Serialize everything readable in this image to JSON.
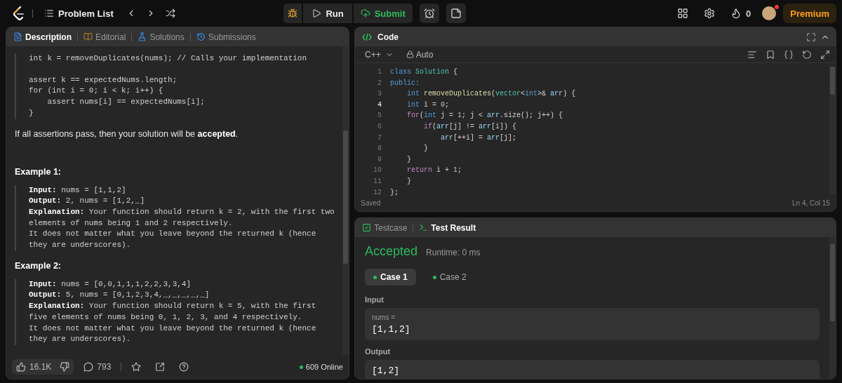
{
  "nav": {
    "problem_list": "Problem List",
    "run": "Run",
    "submit": "Submit",
    "streak": "0",
    "premium": "Premium",
    "notification": true
  },
  "description": {
    "tabs": [
      {
        "label": "Description",
        "selected": true
      },
      {
        "label": "Editorial",
        "selected": false
      },
      {
        "label": "Solutions",
        "selected": false
      },
      {
        "label": "Submissions",
        "selected": false
      }
    ],
    "code_top": [
      [
        "int k = removeDuplicates(nums); // Calls your implementation"
      ],
      [
        "assert k == expectedNums.length;",
        "for (int i = 0; i < k; i++) {",
        "    assert nums[i] == expectedNums[i];",
        "}"
      ]
    ],
    "note": "If all assertions pass, then your solution will be **accepted**.",
    "examples": [
      {
        "title": "Example 1:",
        "lines": [
          "**Input:** nums = [1,1,2]",
          "**Output:** 2, nums = [1,2,_]",
          "**Explanation:** Your function should return k = 2, with the first two elements of nums being 1 and 2 respectively.",
          "It does not matter what you leave beyond the returned k (hence they are underscores)."
        ]
      },
      {
        "title": "Example 2:",
        "lines": [
          "**Input:** nums = [0,0,1,1,1,2,2,3,3,4]",
          "**Output:** 5, nums = [0,1,2,3,4,_,_,_,_,_]",
          "**Explanation:** Your function should return k = 5, with the first five elements of nums being 0, 1, 2, 3, and 4 respectively.",
          "It does not matter what you leave beyond the returned k (hence they are underscores)."
        ]
      }
    ],
    "likes": "16.1K",
    "comments": "793",
    "online": "609 Online"
  },
  "code": {
    "title": "Code",
    "language": "C++",
    "mode": "Auto",
    "status": "Saved",
    "cursor": "Ln 4, Col 15",
    "lines": [
      {
        "n": "1",
        "current": false,
        "tokens": [
          {
            "t": "class ",
            "kind": "keyword"
          },
          {
            "t": "Solution",
            "kind": "type"
          },
          {
            "t": " {",
            "kind": "plain"
          }
        ]
      },
      {
        "n": "2",
        "current": false,
        "tokens": [
          {
            "t": "public:",
            "kind": "keyword"
          }
        ]
      },
      {
        "n": "3",
        "current": false,
        "tokens": [
          {
            "t": "    int ",
            "kind": "keyword"
          },
          {
            "t": "removeDuplicates",
            "kind": "function"
          },
          {
            "t": "(",
            "kind": "plain"
          },
          {
            "t": "vector",
            "kind": "type"
          },
          {
            "t": "<",
            "kind": "plain"
          },
          {
            "t": "int",
            "kind": "keyword"
          },
          {
            "t": ">& ",
            "kind": "plain"
          },
          {
            "t": "arr",
            "kind": "variable"
          },
          {
            "t": ") {",
            "kind": "plain"
          }
        ]
      },
      {
        "n": "4",
        "current": true,
        "tokens": [
          {
            "t": "    int ",
            "kind": "keyword"
          },
          {
            "t": "i = ",
            "kind": "plain"
          },
          {
            "t": "0",
            "kind": "number"
          },
          {
            "t": ";",
            "kind": "plain"
          }
        ]
      },
      {
        "n": "5",
        "current": false,
        "tokens": [
          {
            "t": "    for",
            "kind": "control"
          },
          {
            "t": "(",
            "kind": "plain"
          },
          {
            "t": "int ",
            "kind": "keyword"
          },
          {
            "t": "j = ",
            "kind": "plain"
          },
          {
            "t": "1",
            "kind": "number"
          },
          {
            "t": "; j < ",
            "kind": "plain"
          },
          {
            "t": "arr",
            "kind": "variable"
          },
          {
            "t": ".size(); j++) {",
            "kind": "plain"
          }
        ]
      },
      {
        "n": "6",
        "current": false,
        "tokens": [
          {
            "t": "        if",
            "kind": "control"
          },
          {
            "t": "(",
            "kind": "plain"
          },
          {
            "t": "arr",
            "kind": "variable"
          },
          {
            "t": "[j] != ",
            "kind": "plain"
          },
          {
            "t": "arr",
            "kind": "variable"
          },
          {
            "t": "[i]) {",
            "kind": "plain"
          }
        ]
      },
      {
        "n": "7",
        "current": false,
        "tokens": [
          {
            "t": "            arr",
            "kind": "variable"
          },
          {
            "t": "[++i] = ",
            "kind": "plain"
          },
          {
            "t": "arr",
            "kind": "variable"
          },
          {
            "t": "[j];",
            "kind": "plain"
          }
        ]
      },
      {
        "n": "8",
        "current": false,
        "tokens": [
          {
            "t": "        }",
            "kind": "plain"
          }
        ]
      },
      {
        "n": "9",
        "current": false,
        "tokens": [
          {
            "t": "    }",
            "kind": "plain"
          }
        ]
      },
      {
        "n": "10",
        "current": false,
        "tokens": [
          {
            "t": "    return ",
            "kind": "control"
          },
          {
            "t": "i + ",
            "kind": "plain"
          },
          {
            "t": "1",
            "kind": "number"
          },
          {
            "t": ";",
            "kind": "plain"
          }
        ]
      },
      {
        "n": "11",
        "current": false,
        "tokens": [
          {
            "t": "    }",
            "kind": "plain"
          }
        ]
      },
      {
        "n": "12",
        "current": false,
        "tokens": [
          {
            "t": "};",
            "kind": "plain"
          }
        ]
      }
    ]
  },
  "result": {
    "tabs": [
      {
        "label": "Testcase",
        "selected": false
      },
      {
        "label": "Test Result",
        "selected": true
      }
    ],
    "verdict": "Accepted",
    "runtime": "Runtime: 0 ms",
    "cases": [
      {
        "label": "Case 1",
        "selected": true
      },
      {
        "label": "Case 2",
        "selected": false
      }
    ],
    "input_label": "Input",
    "input_var": "nums =",
    "input_value": "[1,1,2]",
    "output_label": "Output",
    "output_value": "[1,2]"
  }
}
